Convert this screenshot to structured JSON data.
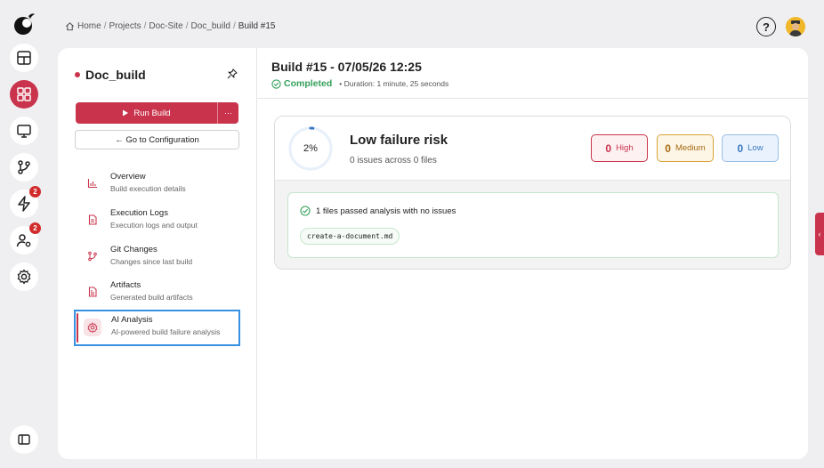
{
  "breadcrumb": {
    "items": [
      "Home",
      "Projects",
      "Doc-Site",
      "Doc_build"
    ],
    "current": "Build #15",
    "separator": "/"
  },
  "header": {
    "help_symbol": "?"
  },
  "rail": {
    "badges": {
      "builds": "2",
      "users": "2"
    }
  },
  "project": {
    "name": "Doc_build",
    "run_label": "Run Build",
    "more_label": "···",
    "config_label": "← Go to Configuration"
  },
  "nav": {
    "items": [
      {
        "title": "Overview",
        "subtitle": "Build execution details"
      },
      {
        "title": "Execution Logs",
        "subtitle": "Execution logs and output"
      },
      {
        "title": "Git Changes",
        "subtitle": "Changes since last build"
      },
      {
        "title": "Artifacts",
        "subtitle": "Generated build artifacts"
      },
      {
        "title": "AI Analysis",
        "subtitle": "AI-powered build failure analysis"
      }
    ]
  },
  "build": {
    "title": "Build #15 - 07/05/26 12:25",
    "status": "Completed",
    "duration": "• Duration: 1 minute, 25 seconds"
  },
  "analysis": {
    "risk_percent": "2%",
    "risk_fraction": 0.02,
    "risk_title": "Low failure risk",
    "risk_summary": "0 issues across 0 files",
    "high_count": "0",
    "high_label": "High",
    "medium_count": "0",
    "medium_label": "Medium",
    "low_count": "0",
    "low_label": "Low",
    "pass_message": "1 files passed analysis with no issues",
    "files": [
      "create-a-document.md"
    ]
  },
  "side_tab": {
    "symbol": "‹"
  },
  "colors": {
    "accent": "#c9344c",
    "success": "#33a05a",
    "medium": "#d9a23a",
    "low": "#3a78c0",
    "focus": "#3791e0"
  }
}
